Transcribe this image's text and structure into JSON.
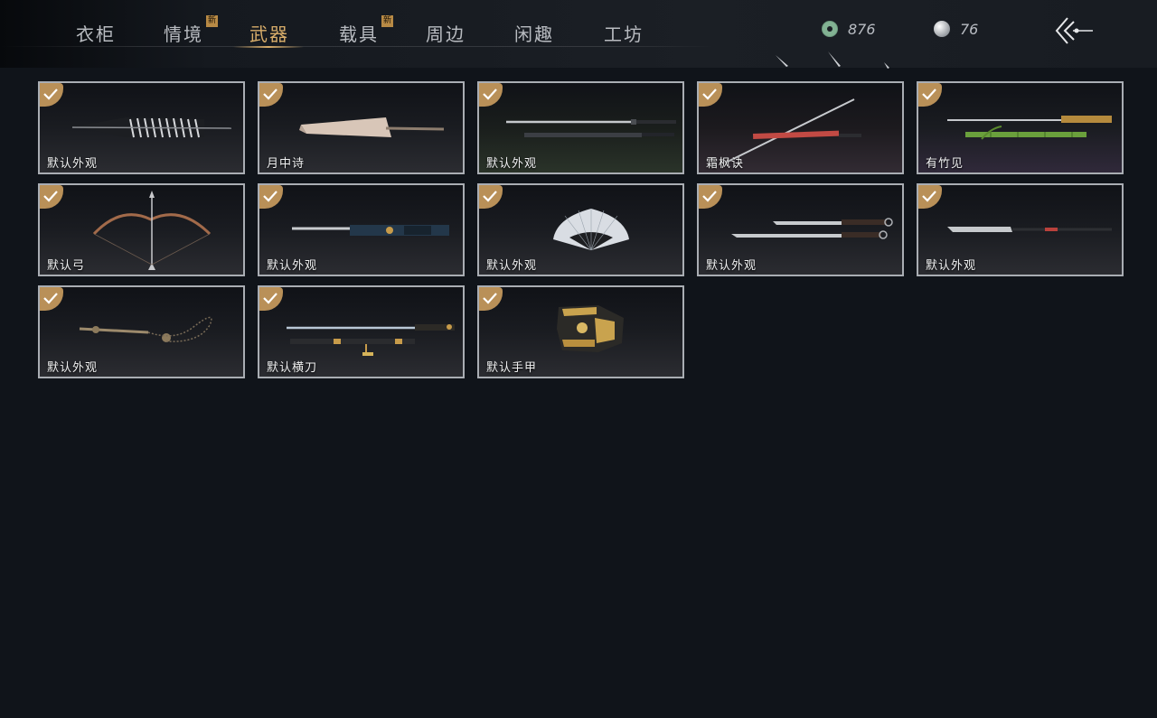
{
  "tabs": [
    {
      "label": "衣柜",
      "badge": ""
    },
    {
      "label": "情境",
      "badge": "新"
    },
    {
      "label": "武器",
      "badge": ""
    },
    {
      "label": "载具",
      "badge": "新"
    },
    {
      "label": "周边",
      "badge": ""
    },
    {
      "label": "闲趣",
      "badge": ""
    },
    {
      "label": "工坊",
      "badge": ""
    }
  ],
  "active_tab": "武器",
  "currency": {
    "jade_coin": "876",
    "pearl": "76"
  },
  "items": [
    {
      "label": "默认外观",
      "icon": "umbrella-weapon-icon",
      "owned": true
    },
    {
      "label": "月中诗",
      "icon": "parasol-weapon-icon",
      "owned": true
    },
    {
      "label": "默认外观",
      "icon": "sword-pair-icon",
      "owned": true
    },
    {
      "label": "霜枫诀",
      "icon": "spear-sword-icon",
      "owned": true
    },
    {
      "label": "有竹见",
      "icon": "bamboo-sword-icon",
      "owned": true
    },
    {
      "label": "默认弓",
      "icon": "bow-icon",
      "owned": true
    },
    {
      "label": "默认外观",
      "icon": "ornate-blade-icon",
      "owned": true
    },
    {
      "label": "默认外观",
      "icon": "fan-icon",
      "owned": true
    },
    {
      "label": "默认外观",
      "icon": "twin-blades-icon",
      "owned": true
    },
    {
      "label": "默认外观",
      "icon": "long-spear-icon",
      "owned": true
    },
    {
      "label": "默认外观",
      "icon": "rope-dart-icon",
      "owned": true
    },
    {
      "label": "默认横刀",
      "icon": "hengdao-icon",
      "owned": true
    },
    {
      "label": "默认手甲",
      "icon": "gauntlet-icon",
      "owned": true
    }
  ],
  "colors": {
    "accent": "#d8ad6a",
    "card_border": "#a9adb3",
    "background": "#10141a"
  }
}
